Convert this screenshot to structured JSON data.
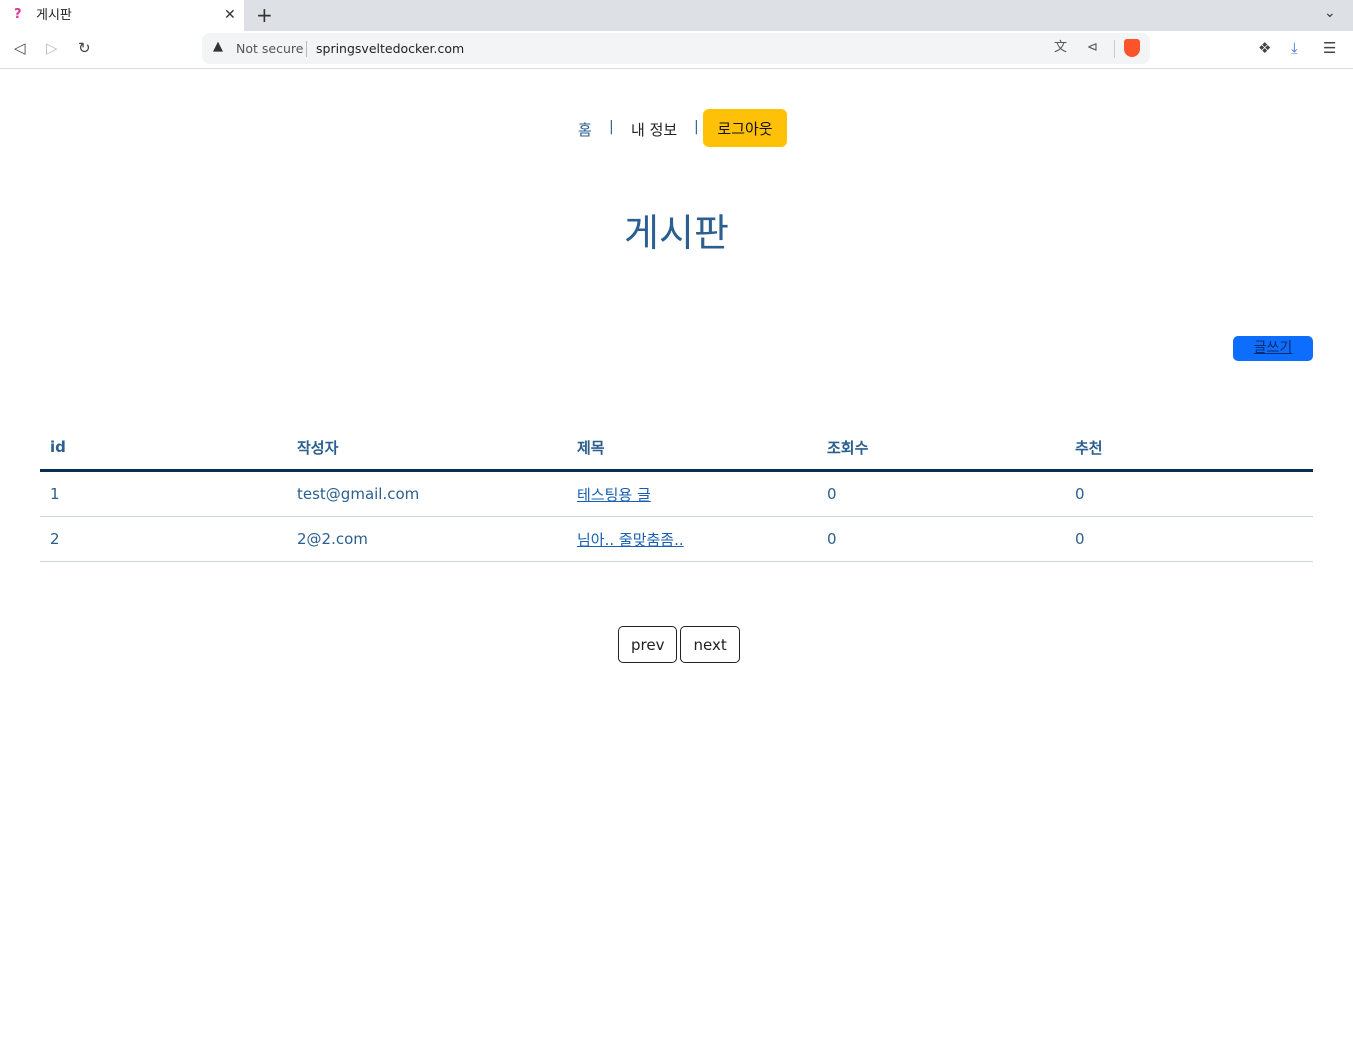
{
  "browser": {
    "tab_title": "게시판",
    "tab_favicon": "?",
    "close_glyph": "✕",
    "new_tab_glyph": "+",
    "not_secure": "Not secure",
    "url": "springsveltedocker.com"
  },
  "nav": {
    "home": "홈",
    "separator": "|",
    "myinfo": "내 정보",
    "logout": "로그아웃"
  },
  "page": {
    "title": "게시판",
    "write_button": "글쓰기"
  },
  "table": {
    "headers": [
      "id",
      "작성자",
      "제목",
      "조회수",
      "추천"
    ],
    "rows": [
      {
        "id": "1",
        "author": "test@gmail.com",
        "title": "테스팅용 글",
        "views": "0",
        "likes": "0"
      },
      {
        "id": "2",
        "author": "2@2.com",
        "title": "님아.. 줄맞춤좀..",
        "views": "0",
        "likes": "0"
      }
    ]
  },
  "pager": {
    "prev": "prev",
    "next": "next"
  },
  "colors": {
    "accent": "#2b5f8f",
    "logout_bg": "#ffc107",
    "write_bg": "#0d6efd",
    "header_rule": "#0a2d52"
  }
}
